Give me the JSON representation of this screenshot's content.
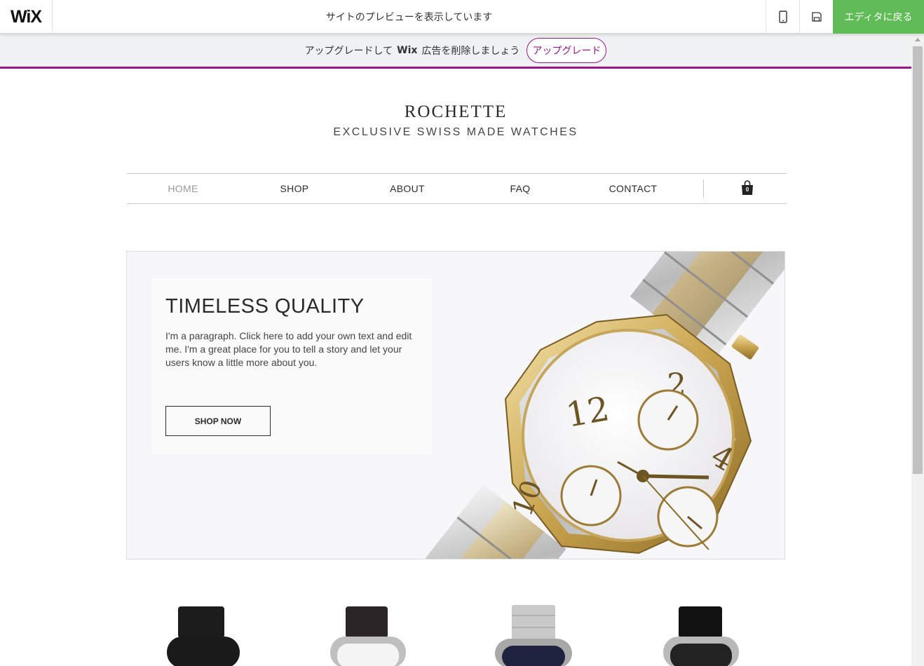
{
  "wix_bar": {
    "logo": "WiX",
    "preview_message": "サイトのプレビューを表示しています",
    "mobile_icon": "mobile-phone-icon",
    "save_icon": "floppy-disk-icon",
    "back_to_editor": "エディタに戻る"
  },
  "upgrade_banner": {
    "text_before": "アップグレードして",
    "wix_word": "Wix",
    "text_after": "広告を削除しましょう",
    "button": "アップグレード",
    "accent_color": "#a0138e"
  },
  "site": {
    "brand_name": "ROCHETTE",
    "tagline": "EXCLUSIVE SWISS MADE WATCHES",
    "nav": [
      {
        "label": "HOME",
        "active": true
      },
      {
        "label": "SHOP",
        "active": false
      },
      {
        "label": "ABOUT",
        "active": false
      },
      {
        "label": "FAQ",
        "active": false
      },
      {
        "label": "CONTACT",
        "active": false
      }
    ],
    "cart": {
      "icon": "shopping-bag-icon",
      "count": "0"
    },
    "hero": {
      "title": "TIMELESS QUALITY",
      "paragraph": "I'm a paragraph. Click here to add your own text and edit me. I'm a great place for you to tell a story and let your users know a little more about you.",
      "button": "SHOP NOW"
    },
    "products": [
      {
        "name": "product-watch-black-strap"
      },
      {
        "name": "product-watch-brown-leather"
      },
      {
        "name": "product-watch-steel-bracelet"
      },
      {
        "name": "product-watch-black-leather"
      }
    ]
  },
  "colors": {
    "editor_button": "#60bc57",
    "upgrade_accent": "#a0138e"
  }
}
